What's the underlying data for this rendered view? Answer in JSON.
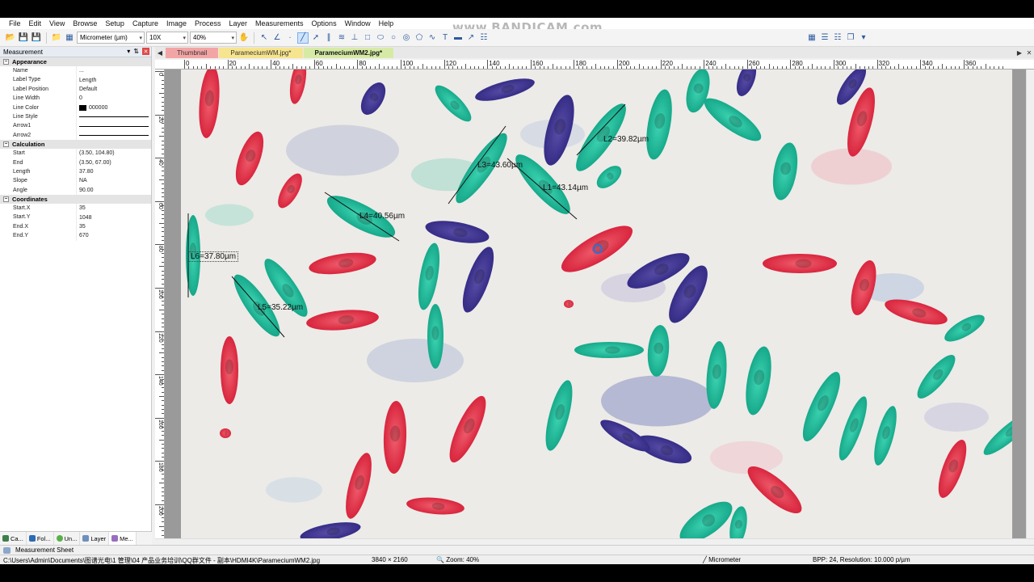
{
  "menu": [
    "File",
    "Edit",
    "View",
    "Browse",
    "Setup",
    "Capture",
    "Image",
    "Process",
    "Layer",
    "Measurements",
    "Options",
    "Window",
    "Help"
  ],
  "watermark": "www.BANDICAM.com",
  "toolbar": {
    "unit_select": "Micrometer (µm)",
    "objective_select": "10X",
    "zoom_select": "40%"
  },
  "panel": {
    "title": "Measurement",
    "sections": {
      "appearance": "Appearance",
      "calculation": "Calculation",
      "coordinates": "Coordinates"
    },
    "appearance_rows": [
      {
        "key": "Name",
        "val": "..."
      },
      {
        "key": "Label Type",
        "val": "Length"
      },
      {
        "key": "Label Position",
        "val": "Default"
      },
      {
        "key": "Line Width",
        "val": "0"
      },
      {
        "key": "Line Color",
        "val": "000000"
      },
      {
        "key": "Line Style",
        "val": ""
      },
      {
        "key": "Arrow1",
        "val": ""
      },
      {
        "key": "Arrow2",
        "val": ""
      }
    ],
    "calculation_rows": [
      {
        "key": "Start",
        "val": "(3.50, 104.80)"
      },
      {
        "key": "End",
        "val": "(3.50, 67.00)"
      },
      {
        "key": "Length",
        "val": "37.80"
      },
      {
        "key": "Slope",
        "val": "NA"
      },
      {
        "key": "Angle",
        "val": "90.00"
      }
    ],
    "coordinate_rows": [
      {
        "key": "Start.X",
        "val": "35"
      },
      {
        "key": "Start.Y",
        "val": "1048"
      },
      {
        "key": "End.X",
        "val": "35"
      },
      {
        "key": "End.Y",
        "val": "670"
      }
    ],
    "bottom_tabs": [
      "Ca...",
      "Fol...",
      "Un...",
      "Layer",
      "Me..."
    ]
  },
  "doc_tabs": [
    "Thumbnail",
    "ParameciumWM.jpg*",
    "ParameciumWM2.jpg*"
  ],
  "ruler": {
    "h_labels": [
      "0",
      "20",
      "40",
      "60",
      "80",
      "100",
      "120",
      "140",
      "160",
      "180",
      "200",
      "220",
      "240",
      "260",
      "280",
      "300",
      "320",
      "340",
      "360"
    ],
    "v_labels": [
      "0",
      "20",
      "40",
      "60",
      "80",
      "100",
      "120",
      "140",
      "160",
      "180",
      "200"
    ]
  },
  "measurements": {
    "l1": "L1=43.14µm",
    "l2": "L2=39.82µm",
    "l3": "L3=43.60µm",
    "l4": "L4=40.56µm",
    "l5": "L5=35.22µm",
    "l6": "L6=37.80µm"
  },
  "sheet_tab": "Measurement Sheet",
  "status": {
    "path": "C:\\Users\\Admin\\Documents\\图谱光电\\1 管理\\04 产品业务培训\\QQ群文件 - 副本\\HDMI4K\\ParameciumWM2.jpg",
    "dimensions": "3840 × 2160",
    "zoom": "Zoom: 40%",
    "unit": "Micrometer",
    "bpp": "BPP: 24, Resolution: 10.000 p/µm"
  }
}
